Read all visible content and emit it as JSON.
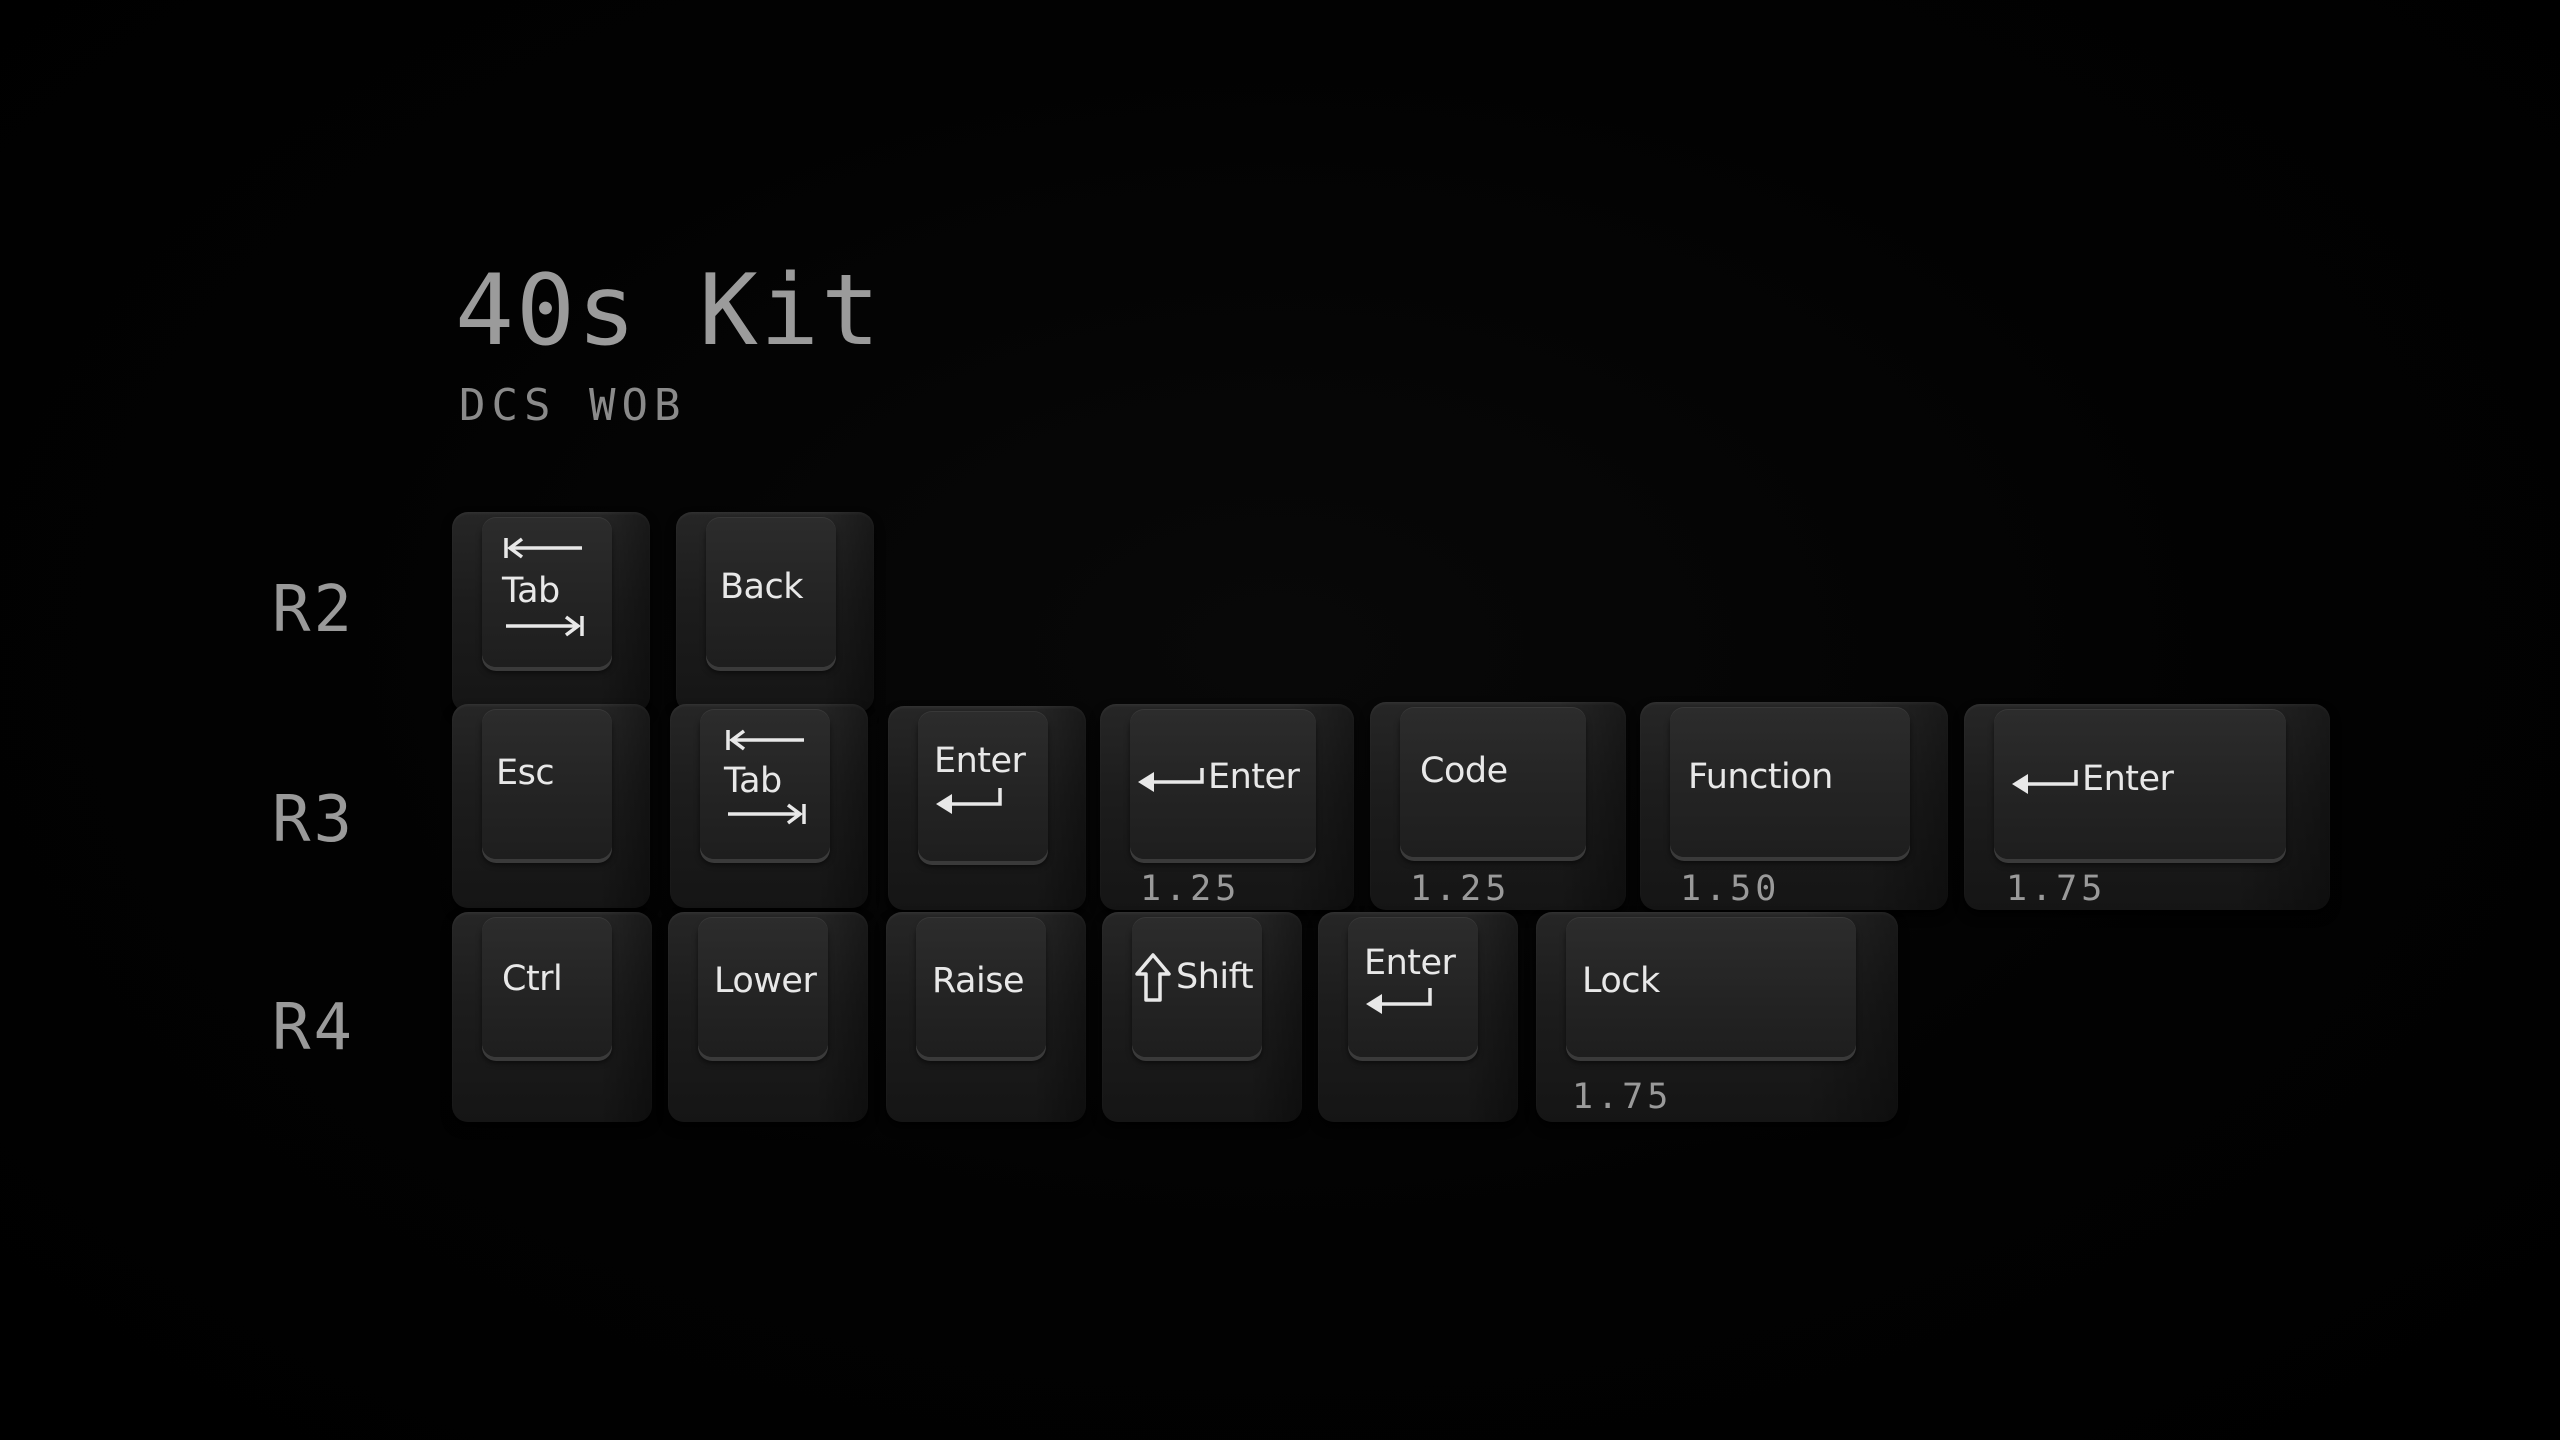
{
  "header": {
    "title": "40s Kit",
    "subtitle": "DCS WOB"
  },
  "rows": {
    "r2": "R2",
    "r3": "R3",
    "r4": "R4"
  },
  "keys": {
    "r2_tab": "Tab",
    "r2_back": "Back",
    "r3_esc": "Esc",
    "r3_tab": "Tab",
    "r3_enter": "Enter",
    "r3_enter_125": "Enter",
    "r3_code": "Code",
    "r3_function": "Function",
    "r3_enter_175": "Enter",
    "r4_ctrl": "Ctrl",
    "r4_lower": "Lower",
    "r4_raise": "Raise",
    "r4_shift": "Shift",
    "r4_enter": "Enter",
    "r4_lock": "Lock"
  },
  "sizes": {
    "r3_enter": "1.25",
    "r3_code": "1.25",
    "r3_function": "1.50",
    "r3_enter_wide": "1.75",
    "r4_lock": "1.75"
  },
  "icons": {
    "tab_back": "arrow-left-to-bar-icon",
    "tab_forward": "arrow-right-to-bar-icon",
    "return": "return-arrow-icon",
    "shift": "shift-arrow-icon"
  },
  "colors": {
    "background": "#000000",
    "keycap": "#1e1e1e",
    "legend": "#e8e8e8",
    "label": "#9a9a9a"
  }
}
